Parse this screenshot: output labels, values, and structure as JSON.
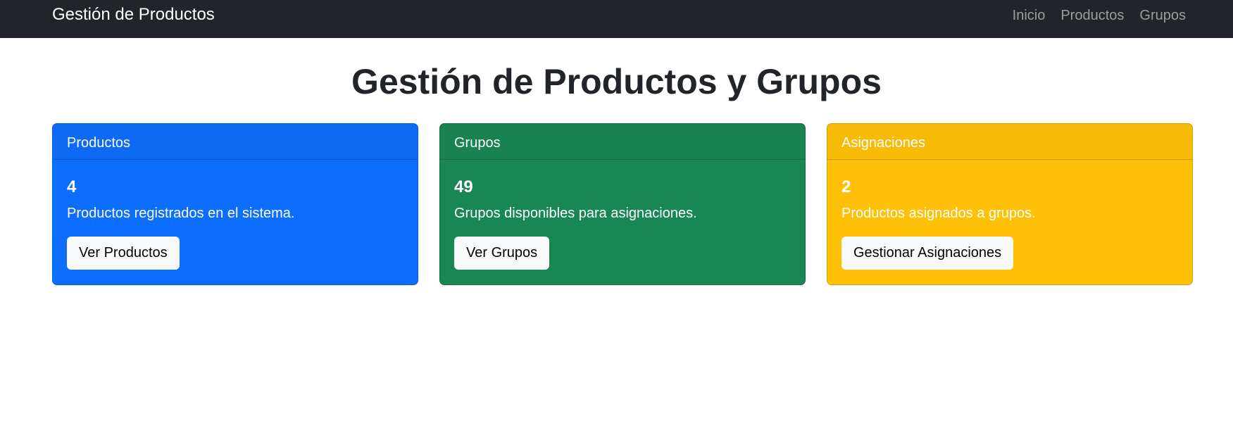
{
  "navbar": {
    "brand": "Gestión de Productos",
    "links": [
      "Inicio",
      "Productos",
      "Grupos"
    ]
  },
  "main": {
    "title": "Gestión de Productos y Grupos",
    "cards": [
      {
        "header": "Productos",
        "count": "4",
        "description": "Productos registrados en el sistema.",
        "button": "Ver Productos",
        "color": "#0d6efd"
      },
      {
        "header": "Grupos",
        "count": "49",
        "description": "Grupos disponibles para asignaciones.",
        "button": "Ver Grupos",
        "color": "#198754"
      },
      {
        "header": "Asignaciones",
        "count": "2",
        "description": "Productos asignados a grupos.",
        "button": "Gestionar Asignaciones",
        "color": "#ffc107"
      }
    ]
  }
}
